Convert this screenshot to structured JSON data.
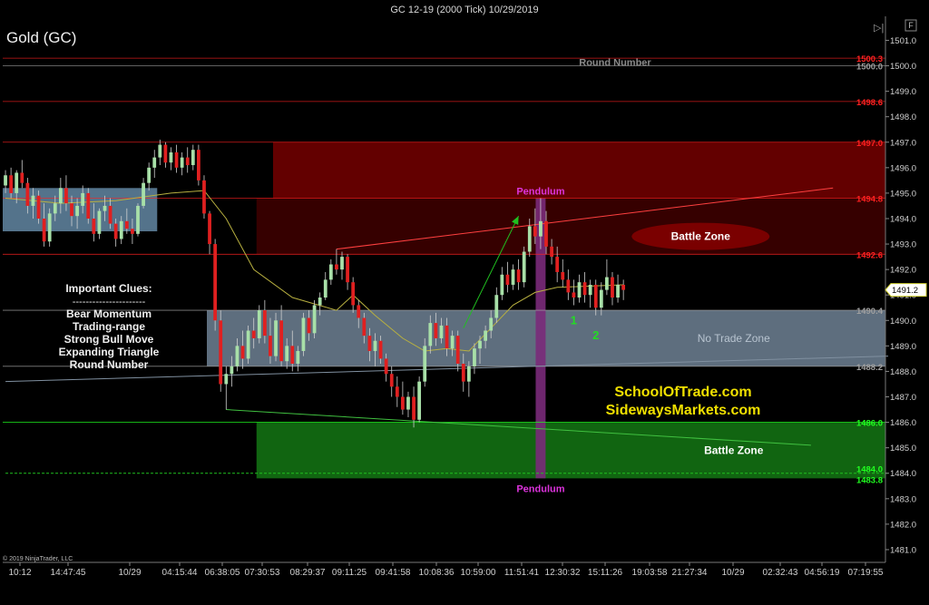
{
  "window_title": "GC 12-19 (2000 Tick)  10/29/2019",
  "instrument_label": "Gold (GC)",
  "copyright": "© 2019 NinjaTrader, LLC",
  "panel_buttons": {
    "play_glyph": "▷|",
    "f_label": "F"
  },
  "watermark": {
    "line1": "SchoolOfTrade.com",
    "line2": "SidewaysMarkets.com"
  },
  "clues": {
    "title": "Important Clues:",
    "divider": "----------------------",
    "items": [
      "Bear Momentum",
      "Trading-range",
      "Strong Bull Move",
      "Expanding Triangle",
      "Round Number"
    ]
  },
  "colors": {
    "bull": "#a8e0a8",
    "bear": "#e02020",
    "resistance": "#7a0000",
    "support": "#127a12",
    "range": "#9ab0c4",
    "pendulum": "#cc33cc"
  },
  "chart_data": {
    "type": "candlestick",
    "title": "GC 12-19 (2000 Tick)  10/29/2019",
    "ylim": [
      1480.5,
      1501.8
    ],
    "y_ticks": [
      1481.0,
      1482.0,
      1483.0,
      1484.0,
      1485.0,
      1486.0,
      1487.0,
      1488.0,
      1489.0,
      1490.0,
      1491.0,
      1492.0,
      1493.0,
      1494.0,
      1495.0,
      1496.0,
      1497.0,
      1498.0,
      1499.0,
      1500.0,
      1501.0
    ],
    "x_tick_labels": [
      "10:12",
      "14:47:45",
      "10/29",
      "04:15:44",
      "06:38:05",
      "07:30:53",
      "08:29:37",
      "09:11:25",
      "09:41:58",
      "10:08:36",
      "10:59:00",
      "11:51:41",
      "12:30:32",
      "15:11:26",
      "19:03:58",
      "21:27:34",
      "10/29",
      "02:32:43",
      "04:56:19",
      "07:19:55"
    ],
    "current_price": 1491.2,
    "current_price_label": "1491.2",
    "price_levels": [
      {
        "value": 1500.3,
        "label": "1500.3",
        "color": "#ff2020"
      },
      {
        "value": 1500.0,
        "label": "1500.0",
        "color": "#a0a0a0",
        "note": "Round Number"
      },
      {
        "value": 1498.6,
        "label": "1498.6",
        "color": "#ff2020"
      },
      {
        "value": 1497.0,
        "label": "1497.0",
        "color": "#ff2020"
      },
      {
        "value": 1494.8,
        "label": "1494.8",
        "color": "#ff2020"
      },
      {
        "value": 1492.6,
        "label": "1492.6",
        "color": "#ff2020"
      },
      {
        "value": 1490.4,
        "label": "1490.4",
        "color": "#a0a0a0"
      },
      {
        "value": 1488.2,
        "label": "1488.2",
        "color": "#a0a0a0"
      },
      {
        "value": 1486.0,
        "label": "1486.0",
        "color": "#20ff20"
      },
      {
        "value": 1484.0,
        "label": "1484.0",
        "color": "#20ff20"
      },
      {
        "value": 1483.8,
        "label": "1483.8",
        "color": "#20ff20"
      }
    ],
    "zones": [
      {
        "name": "resistance-upper",
        "from_bar": 49,
        "to_bar": 160,
        "low": 1494.8,
        "high": 1497.0,
        "color": "#6e0000"
      },
      {
        "name": "resistance-lower",
        "from_bar": 46,
        "to_bar": 160,
        "low": 1492.6,
        "high": 1494.8,
        "color": "#3c0000"
      },
      {
        "name": "no-trade-zone",
        "from_bar": 37,
        "to_bar": 160,
        "low": 1488.2,
        "high": 1490.4,
        "color": "#7d93a8",
        "label": "No Trade Zone"
      },
      {
        "name": "early-range",
        "from_bar": 0,
        "to_bar": 28,
        "low": 1493.5,
        "high": 1495.2,
        "color": "#5d7f9a"
      },
      {
        "name": "support",
        "from_bar": 46,
        "to_bar": 160,
        "low": 1483.8,
        "high": 1486.0,
        "color": "#137013",
        "label": "Battle Zone"
      }
    ],
    "battle_zone_upper": {
      "label": "Battle Zone",
      "price": 1493.3
    },
    "pendulum": {
      "bar": 97,
      "low": 1483.8,
      "high": 1494.8,
      "top_label": "Pendulum",
      "bottom_label": "Pendulum"
    },
    "wave_labels": [
      {
        "text": "1",
        "bar": 103,
        "price": 1490.0
      },
      {
        "text": "2",
        "bar": 107,
        "price": 1489.4
      }
    ],
    "trend_lines": [
      {
        "from": [
          60,
          1492.8
        ],
        "to": [
          150,
          1495.2
        ],
        "color": "#ff4040"
      },
      {
        "from": [
          40,
          1486.5
        ],
        "to": [
          146,
          1485.1
        ],
        "color": "#40c040"
      },
      {
        "from": [
          0,
          1487.6
        ],
        "to": [
          160,
          1488.6
        ],
        "color": "#8090a0"
      },
      {
        "from": [
          0,
          1484.0
        ],
        "to": [
          160,
          1484.0
        ],
        "color": "#20c020",
        "dashed": true
      }
    ],
    "arrow": {
      "from": [
        83,
        1489.7
      ],
      "to": [
        93,
        1494.1
      ],
      "color": "#20c020"
    },
    "ma": [
      [
        0,
        1494.8
      ],
      [
        10,
        1494.6
      ],
      [
        20,
        1494.7
      ],
      [
        30,
        1495.0
      ],
      [
        36,
        1495.1
      ],
      [
        40,
        1494.0
      ],
      [
        45,
        1492.0
      ],
      [
        52,
        1490.9
      ],
      [
        60,
        1490.4
      ],
      [
        63,
        1491.0
      ],
      [
        67,
        1490.2
      ],
      [
        72,
        1489.3
      ],
      [
        76,
        1488.8
      ],
      [
        80,
        1488.9
      ],
      [
        84,
        1488.8
      ],
      [
        88,
        1489.7
      ],
      [
        92,
        1490.6
      ],
      [
        96,
        1491.1
      ],
      [
        100,
        1491.3
      ],
      [
        112,
        1491.4
      ]
    ],
    "candles": [
      [
        1495.3,
        1495.9,
        1495.0,
        1495.7
      ],
      [
        1495.7,
        1496.0,
        1494.8,
        1495.0
      ],
      [
        1495.0,
        1495.9,
        1494.6,
        1495.8
      ],
      [
        1495.8,
        1496.3,
        1495.2,
        1495.4
      ],
      [
        1495.4,
        1495.6,
        1494.2,
        1494.5
      ],
      [
        1494.5,
        1495.2,
        1494.0,
        1494.9
      ],
      [
        1494.9,
        1495.1,
        1493.8,
        1494.0
      ],
      [
        1494.0,
        1494.6,
        1492.9,
        1493.1
      ],
      [
        1493.1,
        1494.4,
        1492.9,
        1494.2
      ],
      [
        1494.2,
        1494.9,
        1493.9,
        1494.6
      ],
      [
        1494.6,
        1495.6,
        1494.2,
        1495.2
      ],
      [
        1495.2,
        1495.7,
        1494.3,
        1494.6
      ],
      [
        1494.6,
        1494.9,
        1493.7,
        1494.1
      ],
      [
        1494.1,
        1494.8,
        1493.6,
        1494.5
      ],
      [
        1494.5,
        1495.3,
        1494.2,
        1495.0
      ],
      [
        1495.0,
        1495.2,
        1493.8,
        1494.0
      ],
      [
        1494.0,
        1494.6,
        1493.1,
        1493.4
      ],
      [
        1493.4,
        1494.4,
        1493.2,
        1494.3
      ],
      [
        1494.3,
        1494.9,
        1493.9,
        1494.5
      ],
      [
        1494.5,
        1494.8,
        1493.6,
        1493.8
      ],
      [
        1493.8,
        1494.0,
        1492.9,
        1493.2
      ],
      [
        1493.2,
        1494.1,
        1493.0,
        1493.9
      ],
      [
        1493.9,
        1494.4,
        1493.4,
        1493.6
      ],
      [
        1493.6,
        1494.0,
        1493.0,
        1493.4
      ],
      [
        1493.4,
        1494.6,
        1493.3,
        1494.5
      ],
      [
        1494.5,
        1495.6,
        1494.4,
        1495.4
      ],
      [
        1495.4,
        1496.2,
        1495.1,
        1496.0
      ],
      [
        1496.0,
        1496.7,
        1495.6,
        1496.4
      ],
      [
        1496.4,
        1497.1,
        1496.1,
        1496.9
      ],
      [
        1496.9,
        1497.0,
        1496.0,
        1496.2
      ],
      [
        1496.2,
        1496.8,
        1495.9,
        1496.6
      ],
      [
        1496.6,
        1496.9,
        1495.8,
        1496.0
      ],
      [
        1496.0,
        1496.6,
        1495.7,
        1496.4
      ],
      [
        1496.4,
        1496.8,
        1495.8,
        1496.1
      ],
      [
        1496.1,
        1496.9,
        1495.9,
        1496.7
      ],
      [
        1496.7,
        1496.9,
        1495.3,
        1495.5
      ],
      [
        1495.5,
        1495.7,
        1494.0,
        1494.2
      ],
      [
        1494.2,
        1494.3,
        1492.6,
        1493.0
      ],
      [
        1493.0,
        1493.2,
        1489.6,
        1490.0
      ],
      [
        1490.0,
        1490.4,
        1487.2,
        1487.5
      ],
      [
        1487.5,
        1488.2,
        1486.5,
        1487.9
      ],
      [
        1487.9,
        1488.6,
        1487.4,
        1488.2
      ],
      [
        1488.2,
        1489.3,
        1488.0,
        1489.0
      ],
      [
        1489.0,
        1489.6,
        1488.1,
        1488.5
      ],
      [
        1488.5,
        1489.8,
        1488.3,
        1489.6
      ],
      [
        1489.6,
        1490.1,
        1488.9,
        1489.3
      ],
      [
        1489.3,
        1490.6,
        1489.1,
        1490.4
      ],
      [
        1490.4,
        1490.8,
        1489.1,
        1489.4
      ],
      [
        1489.4,
        1490.1,
        1488.3,
        1488.6
      ],
      [
        1488.6,
        1490.3,
        1488.4,
        1490.0
      ],
      [
        1490.0,
        1490.6,
        1488.2,
        1488.4
      ],
      [
        1488.4,
        1489.3,
        1488.1,
        1489.0
      ],
      [
        1489.0,
        1489.6,
        1488.0,
        1488.3
      ],
      [
        1488.3,
        1489.0,
        1488.0,
        1488.8
      ],
      [
        1488.8,
        1490.3,
        1488.6,
        1490.1
      ],
      [
        1490.1,
        1490.4,
        1489.2,
        1489.5
      ],
      [
        1489.5,
        1490.8,
        1489.3,
        1490.6
      ],
      [
        1490.6,
        1491.1,
        1490.2,
        1490.9
      ],
      [
        1490.9,
        1491.9,
        1490.8,
        1491.6
      ],
      [
        1491.6,
        1492.4,
        1491.4,
        1492.2
      ],
      [
        1492.2,
        1492.8,
        1491.8,
        1492.0
      ],
      [
        1492.0,
        1492.7,
        1491.6,
        1492.5
      ],
      [
        1492.5,
        1492.6,
        1491.2,
        1491.5
      ],
      [
        1491.5,
        1491.7,
        1490.3,
        1490.6
      ],
      [
        1490.6,
        1490.8,
        1489.7,
        1490.1
      ],
      [
        1490.1,
        1490.3,
        1489.1,
        1489.4
      ],
      [
        1489.4,
        1489.7,
        1488.4,
        1488.8
      ],
      [
        1488.8,
        1489.5,
        1488.2,
        1489.2
      ],
      [
        1489.2,
        1489.4,
        1488.3,
        1488.5
      ],
      [
        1488.5,
        1488.7,
        1487.6,
        1487.9
      ],
      [
        1487.9,
        1488.2,
        1487.0,
        1487.4
      ],
      [
        1487.4,
        1487.8,
        1486.6,
        1487.0
      ],
      [
        1487.0,
        1487.6,
        1486.3,
        1486.5
      ],
      [
        1486.5,
        1487.2,
        1486.2,
        1487.0
      ],
      [
        1487.0,
        1487.4,
        1485.8,
        1486.1
      ],
      [
        1486.1,
        1487.8,
        1486.0,
        1487.6
      ],
      [
        1487.6,
        1489.3,
        1487.4,
        1489.0
      ],
      [
        1489.0,
        1490.2,
        1488.7,
        1489.9
      ],
      [
        1489.9,
        1490.3,
        1489.0,
        1489.3
      ],
      [
        1489.3,
        1490.1,
        1489.1,
        1489.8
      ],
      [
        1489.8,
        1490.1,
        1488.6,
        1488.9
      ],
      [
        1488.9,
        1489.6,
        1488.6,
        1489.4
      ],
      [
        1489.4,
        1489.6,
        1488.0,
        1488.3
      ],
      [
        1488.3,
        1488.7,
        1487.2,
        1487.6
      ],
      [
        1487.6,
        1488.4,
        1487.0,
        1488.2
      ],
      [
        1488.2,
        1489.1,
        1487.9,
        1488.9
      ],
      [
        1488.9,
        1489.4,
        1488.3,
        1489.2
      ],
      [
        1489.2,
        1489.8,
        1488.9,
        1489.6
      ],
      [
        1489.6,
        1490.4,
        1489.3,
        1490.1
      ],
      [
        1490.1,
        1491.3,
        1489.9,
        1491.0
      ],
      [
        1491.0,
        1492.1,
        1490.8,
        1491.8
      ],
      [
        1491.8,
        1492.3,
        1491.1,
        1491.4
      ],
      [
        1491.4,
        1492.2,
        1491.2,
        1492.0
      ],
      [
        1492.0,
        1492.4,
        1491.2,
        1491.5
      ],
      [
        1491.5,
        1492.9,
        1491.3,
        1492.7
      ],
      [
        1492.7,
        1494.0,
        1492.5,
        1493.7
      ],
      [
        1493.7,
        1494.4,
        1493.0,
        1493.3
      ],
      [
        1493.3,
        1494.8,
        1492.8,
        1493.9
      ],
      [
        1493.9,
        1494.3,
        1492.6,
        1492.9
      ],
      [
        1492.9,
        1493.2,
        1492.2,
        1492.5
      ],
      [
        1492.5,
        1492.9,
        1491.5,
        1491.9
      ],
      [
        1491.9,
        1492.4,
        1491.3,
        1491.6
      ],
      [
        1491.6,
        1492.0,
        1490.8,
        1491.1
      ],
      [
        1491.1,
        1491.6,
        1490.6,
        1490.9
      ],
      [
        1490.9,
        1491.8,
        1490.7,
        1491.5
      ],
      [
        1491.5,
        1491.9,
        1490.7,
        1491.0
      ],
      [
        1491.0,
        1491.6,
        1490.5,
        1491.4
      ],
      [
        1491.4,
        1491.6,
        1490.2,
        1490.5
      ],
      [
        1490.5,
        1491.5,
        1490.2,
        1491.2
      ],
      [
        1491.2,
        1492.4,
        1491.0,
        1491.7
      ],
      [
        1491.7,
        1491.9,
        1490.6,
        1490.9
      ],
      [
        1490.9,
        1491.8,
        1490.7,
        1491.4
      ],
      [
        1491.4,
        1491.6,
        1490.8,
        1491.2
      ]
    ]
  }
}
